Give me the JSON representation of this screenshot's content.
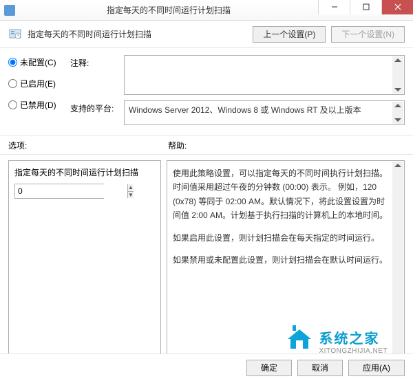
{
  "titlebar": {
    "title": "指定每天的不同时间运行计划扫描"
  },
  "subheader": {
    "title": "指定每天的不同时间运行计划扫描",
    "prev_label": "上一个设置(P)",
    "next_label": "下一个设置(N)"
  },
  "radios": {
    "not_configured": "未配置(C)",
    "enabled": "已启用(E)",
    "disabled": "已禁用(D)",
    "selected": "not_configured"
  },
  "fields": {
    "comment_label": "注释:",
    "comment_value": "",
    "platform_label": "支持的平台:",
    "platform_value": "Windows Server 2012、Windows 8 或 Windows RT 及以上版本"
  },
  "section_labels": {
    "options": "选项:",
    "help": "帮助:"
  },
  "options": {
    "title": "指定每天的不同时间运行计划扫描",
    "value": "0"
  },
  "help": {
    "p1": "使用此策略设置，可以指定每天的不同时间执行计划扫描。时间值采用超过午夜的分钟数 (00:00) 表示。 例如，120 (0x78) 等同于 02:00 AM。默认情况下，将此设置设置为时间值 2:00 AM。计划基于执行扫描的计算机上的本地时间。",
    "p2": "如果启用此设置，则计划扫描会在每天指定的时间运行。",
    "p3": "如果禁用或未配置此设置，则计划扫描会在默认时间运行。"
  },
  "watermark": {
    "cn": "系统之家",
    "en": "XITONGZHIJIA.NET"
  },
  "footer": {
    "ok": "确定",
    "cancel": "取消",
    "apply": "应用(A)"
  }
}
